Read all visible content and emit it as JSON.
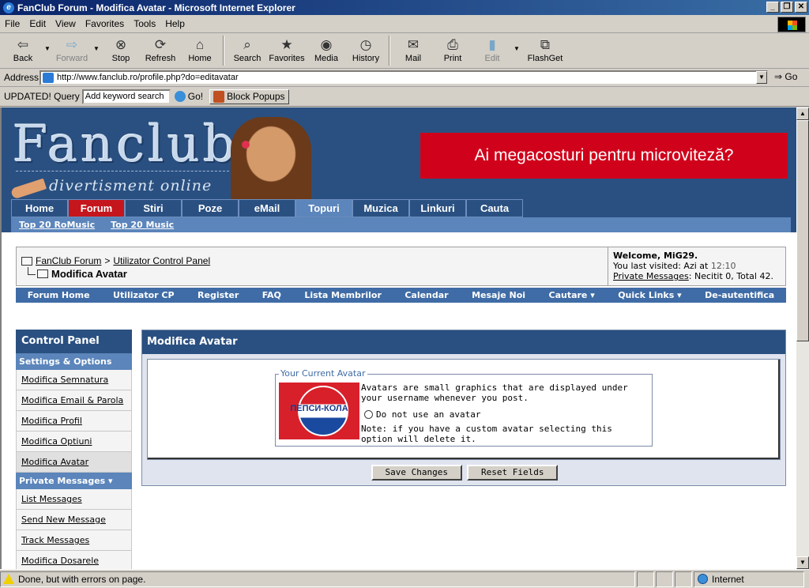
{
  "window": {
    "title": "FanClub Forum - Modifica Avatar - Microsoft Internet Explorer",
    "buttons": [
      "_",
      "❐",
      "✕"
    ]
  },
  "menu": [
    "File",
    "Edit",
    "View",
    "Favorites",
    "Tools",
    "Help"
  ],
  "toolbar": {
    "back": "Back",
    "forward": "Forward",
    "stop": "Stop",
    "refresh": "Refresh",
    "home": "Home",
    "search": "Search",
    "favorites": "Favorites",
    "media": "Media",
    "history": "History",
    "mail": "Mail",
    "print": "Print",
    "edit": "Edit",
    "flashget": "FlashGet"
  },
  "address": {
    "label": "Address",
    "url": "http://www.fanclub.ro/profile.php?do=editavatar",
    "go": "Go"
  },
  "query": {
    "label": "UPDATED! Query",
    "value": "Add keyword search",
    "go": "Go!",
    "block": "Block Popups"
  },
  "site": {
    "logo": "Fanclub",
    "tagline": "divertisment online",
    "banner": "Ai megacosturi pentru microviteză?",
    "tabs": [
      "Home",
      "Forum",
      "Stiri",
      "Poze",
      "eMail",
      "Topuri",
      "Muzica",
      "Linkuri",
      "Cauta"
    ],
    "subnav": [
      "Top 20 RoMusic",
      "Top 20 Music"
    ]
  },
  "breadcrumb": {
    "forum": "FanClub Forum",
    "sep": ">",
    "ucp": "Utilizator Control Panel",
    "current": "Modifica Avatar"
  },
  "welcome": {
    "greeting": "Welcome, MiG29.",
    "last_visited_label": "You last visited: Azi at",
    "last_visited_time": "12:10",
    "pm_link": "Private Messages",
    "pm_stats": ": Necitit 0, Total 42."
  },
  "forumnav": [
    "Forum Home",
    "Utilizator CP",
    "Register",
    "FAQ",
    "Lista Membrilor",
    "Calendar",
    "Mesaje Noi",
    "Cautare ▾",
    "Quick Links ▾",
    "De-autentifica"
  ],
  "control_panel": {
    "title": "Control Panel",
    "section1": "Settings & Options",
    "items1": [
      "Modifica Semnatura",
      "Modifica Email & Parola",
      "Modifica Profil",
      "Modifica Optiuni",
      "Modifica Avatar"
    ],
    "section2": "Private Messages ▾",
    "items2": [
      "List Messages",
      "Send New Message",
      "Track Messages",
      "Modifica Dosarele"
    ]
  },
  "avatar_form": {
    "title": "Modifica Avatar",
    "legend": "Your Current Avatar",
    "avatar_text": "ПЕПСИ-КОЛА",
    "description": "Avatars are small graphics that are displayed under your username whenever you post.",
    "radio_label": "Do not use an avatar",
    "note": "Note: if you have a custom avatar selecting this option will delete it.",
    "save": "Save Changes",
    "reset": "Reset Fields"
  },
  "status": {
    "text": "Done, but with errors on page.",
    "zone": "Internet"
  }
}
